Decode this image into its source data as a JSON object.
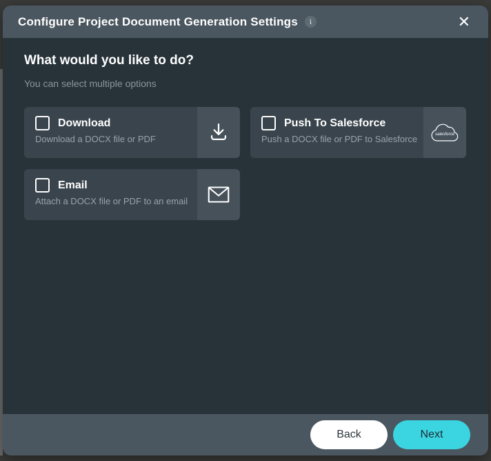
{
  "modal": {
    "title": "Configure Project Document Generation Settings",
    "info_icon_glyph": "i",
    "close_icon_glyph": "✕",
    "heading": "What would you like to do?",
    "subheading": "You can select multiple options",
    "options": [
      {
        "label": "Download",
        "description": "Download a DOCX file or PDF",
        "icon": "download-icon",
        "checked": false
      },
      {
        "label": "Push To Salesforce",
        "description": "Push a DOCX file or PDF to Salesforce",
        "icon": "salesforce-icon",
        "icon_text": "salesforce",
        "checked": false
      },
      {
        "label": "Email",
        "description": "Attach a DOCX file or PDF to an email",
        "icon": "email-icon",
        "checked": false
      }
    ],
    "footer": {
      "back_label": "Back",
      "next_label": "Next"
    },
    "colors": {
      "accent": "#3bd5e2",
      "header_bar": "#4b5760",
      "body_background": "#273239",
      "card_background": "#39444c",
      "icon_panel_background": "#46515a"
    }
  }
}
